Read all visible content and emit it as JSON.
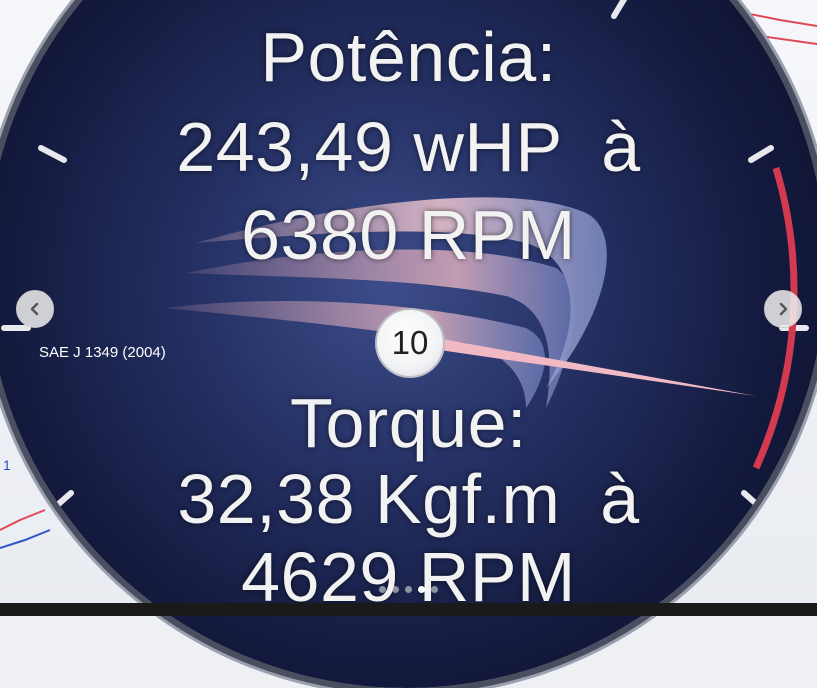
{
  "power": {
    "label": "Potência:",
    "value_line": "243,49 wHP  à",
    "rpm_line": "6380 RPM"
  },
  "standard": "SAE J 1349 (2004)",
  "gauge": {
    "hub_number": "10"
  },
  "torque": {
    "label": "Torque:",
    "value_line": "32,38 Kgf.m  à",
    "rpm_line": "4629 RPM"
  },
  "side_number": "1",
  "carousel": {
    "prev_icon": "chevron-left-icon",
    "next_icon": "chevron-right-icon",
    "dot_count": 5,
    "active_dot": 3
  },
  "colors": {
    "gauge_dark": "#080b1e",
    "gauge_mid": "#263266",
    "needle": "#f0b9c4",
    "redline": "#d43a4f"
  }
}
